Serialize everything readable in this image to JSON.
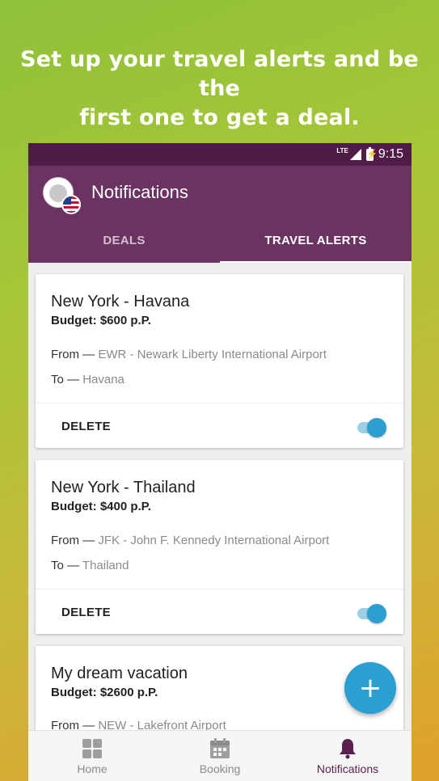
{
  "headline": {
    "line1": "Set up your travel alerts and be the",
    "line2": "first one to get a deal."
  },
  "status_bar": {
    "network": "LTE",
    "time": "9:15"
  },
  "app_bar": {
    "title": "Notifications",
    "tabs": [
      {
        "label": "DEALS",
        "active": false
      },
      {
        "label": "TRAVEL ALERTS",
        "active": true
      }
    ]
  },
  "alerts": [
    {
      "title": "New York - Havana",
      "budget": "Budget: $600 p.P.",
      "from_label": "From —",
      "from_value": "EWR - Newark Liberty International Airport",
      "to_label": "To —",
      "to_value": "Havana",
      "delete_label": "DELETE",
      "enabled": true
    },
    {
      "title": "New York - Thailand",
      "budget": "Budget: $400 p.P.",
      "from_label": "From —",
      "from_value": "JFK - John F. Kennedy International Airport",
      "to_label": "To —",
      "to_value": "Thailand",
      "delete_label": "DELETE",
      "enabled": true
    },
    {
      "title": "My dream vacation",
      "budget": "Budget: $2600 p.P.",
      "from_label": "From —",
      "from_value": "NEW - Lakefront Airport"
    }
  ],
  "fab": {
    "icon": "plus-icon",
    "label": "+"
  },
  "bottom_nav": [
    {
      "label": "Home",
      "icon": "grid-icon",
      "active": false
    },
    {
      "label": "Booking",
      "icon": "calendar-icon",
      "active": false
    },
    {
      "label": "Notifications",
      "icon": "bell-icon",
      "active": true
    }
  ],
  "colors": {
    "status_bar": "#4f1c47",
    "app_bar": "#6a3362",
    "accent": "#2a9fd0",
    "active_nav": "#5a2150",
    "inactive_nav": "#8a8a8a"
  }
}
